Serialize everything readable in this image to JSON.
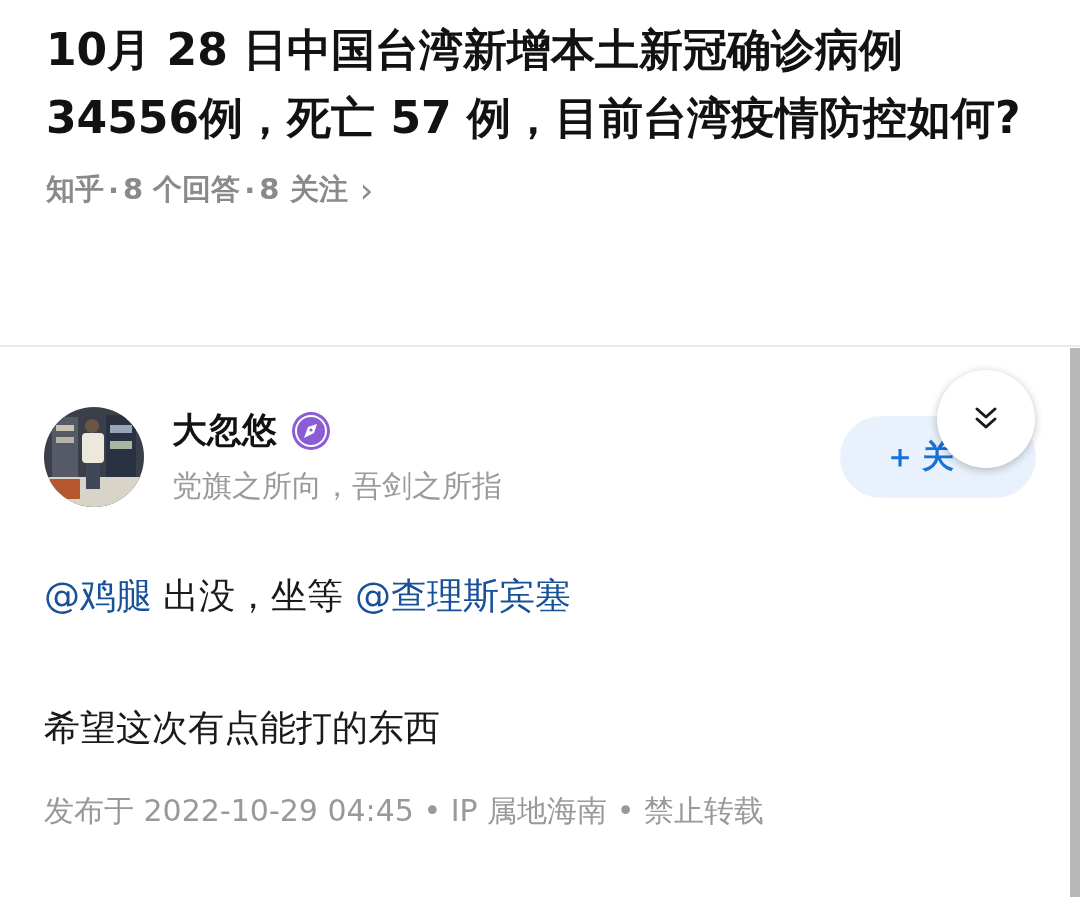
{
  "question": {
    "title": "10月 28 日中国台湾新增本土新冠确诊病例34556例，死亡 57 例，目前台湾疫情防控如何?",
    "meta": [
      "知乎",
      "8 个回答",
      "8 关注"
    ],
    "meta_separator": "·",
    "chevron": "›"
  },
  "answer": {
    "author": {
      "name": "大忽悠",
      "motto": "党旗之所向，吾剑之所指"
    },
    "follow_button": {
      "plus": "＋",
      "label": "关"
    },
    "paragraphs": [
      [
        {
          "kind": "mention",
          "text": "@鸡腿"
        },
        {
          "kind": "text",
          "text": " 出没，坐等 "
        },
        {
          "kind": "mention",
          "text": "@查理斯宾塞"
        }
      ],
      [
        {
          "kind": "text",
          "text": "希望这次有点能打的东西"
        }
      ]
    ],
    "footer": "发布于 2022-10-29 04:45 • IP 属地海南 • 禁止转载"
  }
}
